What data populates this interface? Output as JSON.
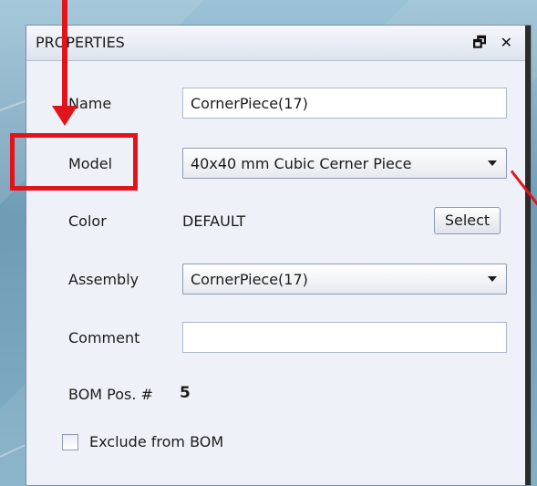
{
  "panel": {
    "title": "PROPERTIES",
    "float_icon": "restore-icon",
    "close_label": "✕"
  },
  "fields": {
    "name_label": "Name",
    "name_value": "CornerPiece(17)",
    "model_label": "Model",
    "model_value": "40x40 mm Cubic Cerner Piece",
    "color_label": "Color",
    "color_value": "DEFAULT",
    "color_button": "Select",
    "assembly_label": "Assembly",
    "assembly_value": "CornerPiece(17)",
    "comment_label": "Comment",
    "comment_value": "",
    "bom_label": "BOM Pos. #",
    "bom_value": "5",
    "exclude_label": "Exclude from BOM",
    "exclude_checked": false
  },
  "annotation": {
    "highlight_color": "#e0151b"
  }
}
